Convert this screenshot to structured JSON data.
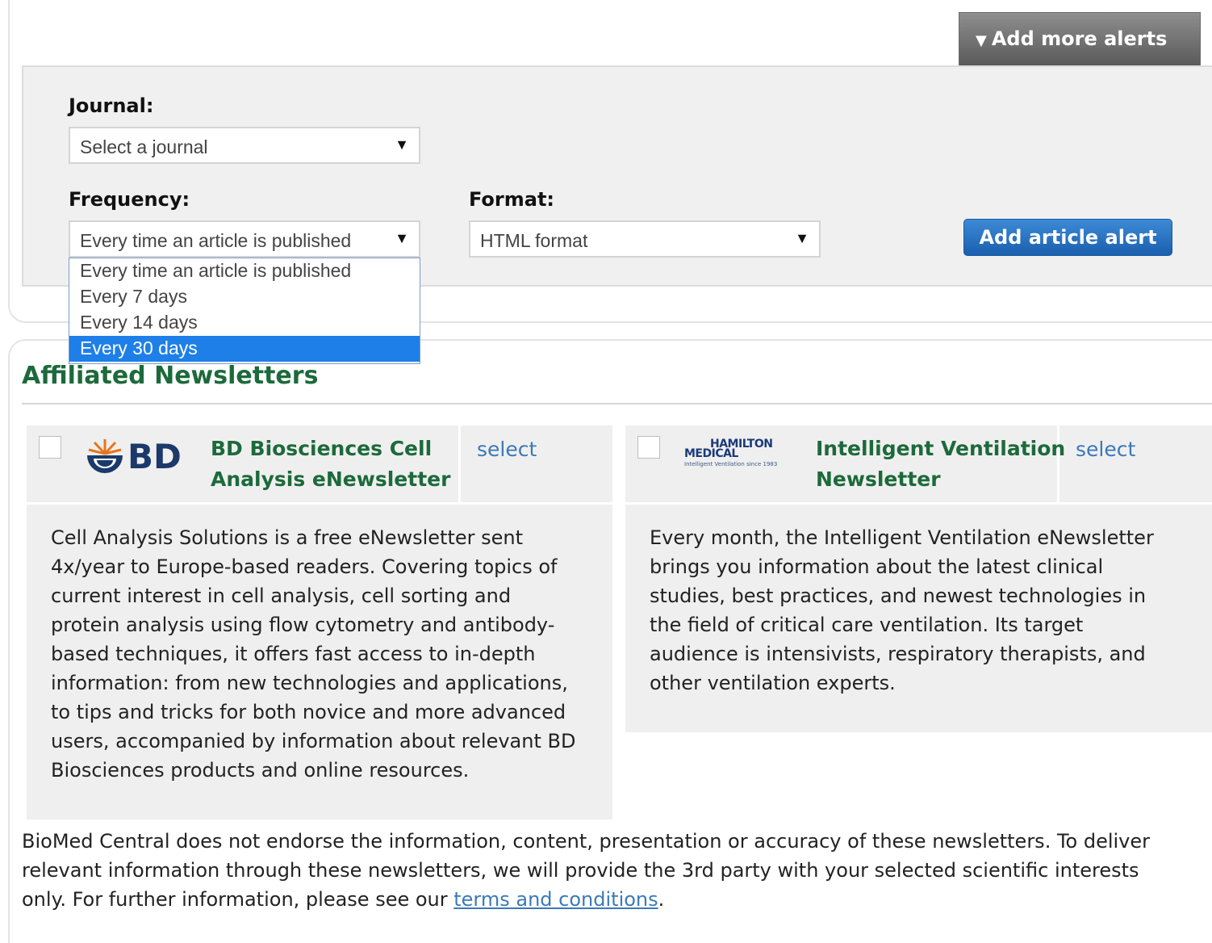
{
  "alerts": {
    "add_more_label": "Add more alerts",
    "journal_label": "Journal:",
    "journal_select_value": "Select a journal",
    "frequency_label": "Frequency:",
    "frequency_select_value": "Every time an article is published",
    "frequency_options": [
      "Every time an article is published",
      "Every 7 days",
      "Every 14 days",
      "Every 30 days"
    ],
    "frequency_highlighted": "Every 30 days",
    "format_label": "Format:",
    "format_select_value": "HTML format",
    "add_button_label": "Add article alert"
  },
  "newsletters": {
    "title": "Affiliated Newsletters",
    "items": [
      {
        "logo_text": "BD",
        "title_line1": "BD Biosciences Cell",
        "title_line2": "Analysis eNewsletter",
        "select_label": "select",
        "description_lines": [
          "Cell Analysis Solutions is a free eNewsletter sent",
          "4x/year to Europe-based readers. Covering topics of",
          "current interest in cell analysis, cell sorting and",
          "protein analysis using flow cytometry and antibody-",
          "based techniques, it offers fast access to in-depth",
          "information: from new technologies and applications,",
          "to tips and tricks for both novice and more advanced",
          "users, accompanied by information about relevant BD",
          "Biosciences products and online resources."
        ]
      },
      {
        "logo_line1": "HAMILTON",
        "logo_line2": "MEDICAL",
        "logo_tagline": "Intelligent Ventilation since 1983",
        "title_line1": "Intelligent Ventilation",
        "title_line2": "Newsletter",
        "select_label": "select",
        "description_lines": [
          "Every month, the Intelligent Ventilation eNewsletter",
          "brings you information about the latest clinical",
          "studies, best practices, and newest technologies in",
          "the field of critical care ventilation. Its target",
          "audience is intensivists, respiratory therapists, and",
          "other ventilation experts."
        ]
      }
    ]
  },
  "disclaimer": {
    "line1": "BioMed Central does not endorse the information, content, presentation or accuracy of these newsletters. To deliver",
    "line2": "relevant information through these newsletters, we will provide the 3rd party with your selected scientific interests",
    "line3_prefix": "only. For further information, please see our ",
    "link_text": "terms and conditions",
    "line3_suffix": "."
  },
  "colors": {
    "heading_green": "#1c6a3b",
    "link_blue": "#3a7ab8",
    "button_blue": "#1a5fae",
    "highlight_blue": "#1e7fe8"
  }
}
